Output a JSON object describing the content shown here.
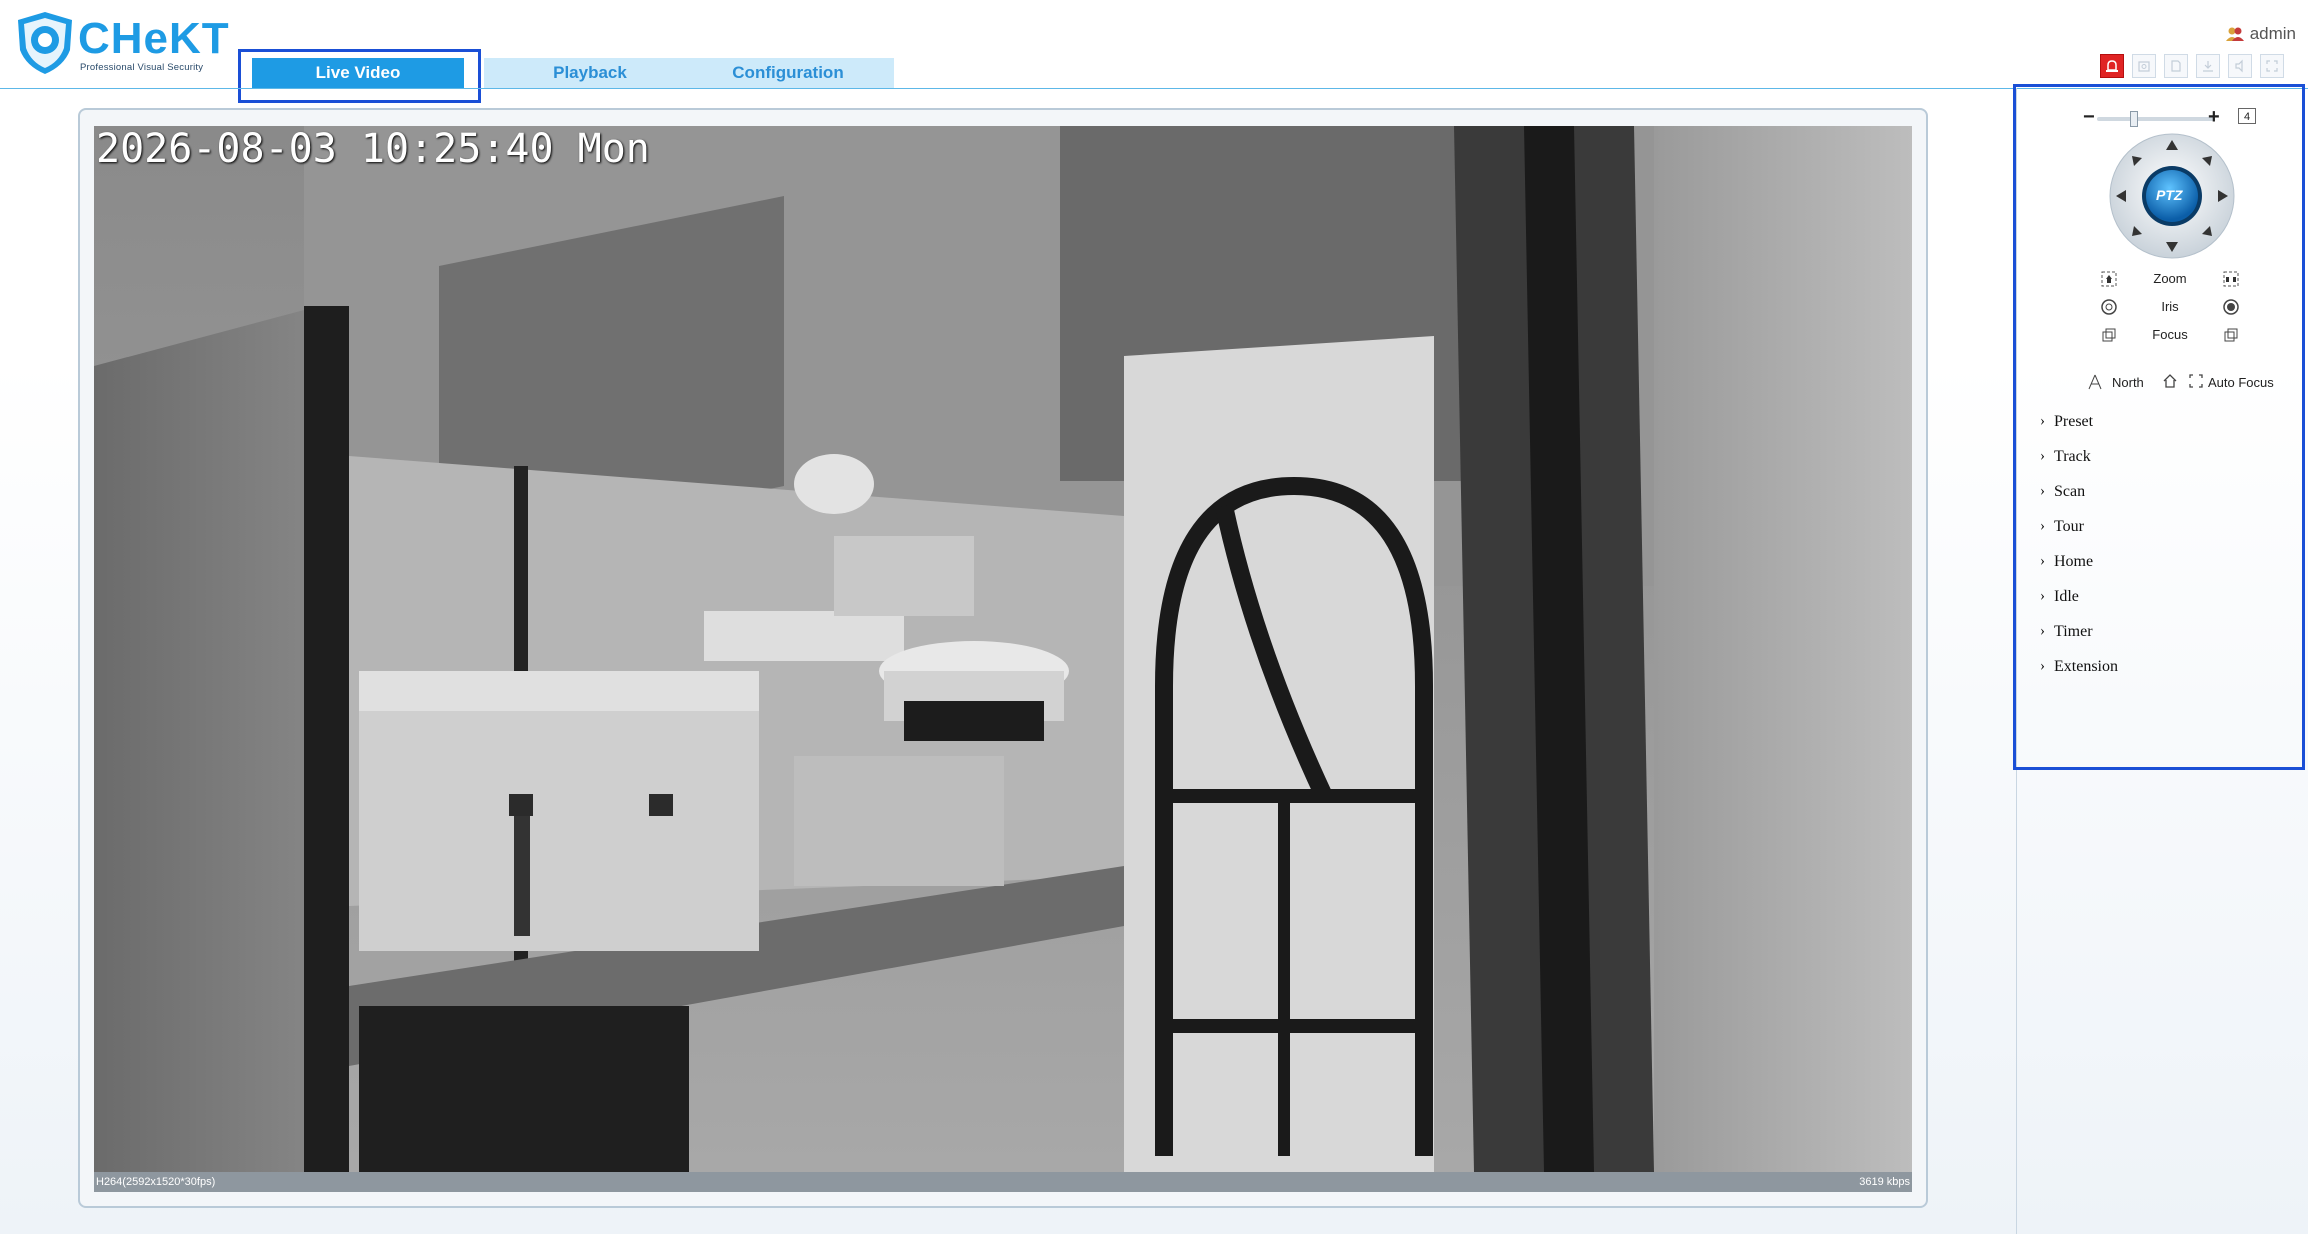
{
  "app": {
    "logo_text": "CHeKT",
    "logo_tagline": "Professional Visual Security",
    "brand_color": "#1e9be4"
  },
  "nav": {
    "tabs": [
      {
        "label": "Live Video",
        "active": true
      },
      {
        "label": "Playback",
        "active": false
      },
      {
        "label": "Configuration",
        "active": false
      }
    ]
  },
  "header": {
    "user": "admin",
    "toolbar_icons": [
      "alarm-icon",
      "snapshot-icon",
      "record-icon",
      "download-icon",
      "audio-icon",
      "fullscreen-icon"
    ]
  },
  "video": {
    "osd_timestamp": "2026-08-03 10:25:40 Mon",
    "stream_info": "H264(2592x1520*30fps)",
    "bitrate": "3619 kbps"
  },
  "ptz": {
    "zoom_value": "4",
    "zoom_fraction": 0.3,
    "center_label": "PTZ",
    "controls": [
      {
        "label": "Zoom",
        "left_icon": "zoom-in-icon",
        "right_icon": "zoom-out-icon"
      },
      {
        "label": "Iris",
        "left_icon": "iris-open-icon",
        "right_icon": "iris-close-icon"
      },
      {
        "label": "Focus",
        "left_icon": "focus-near-icon",
        "right_icon": "focus-far-icon"
      }
    ],
    "north_label": "North",
    "auto_focus_label": "Auto Focus",
    "menu": [
      "Preset",
      "Track",
      "Scan",
      "Tour",
      "Home",
      "Idle",
      "Timer",
      "Extension"
    ]
  },
  "highlight_color": "#1a4fd6"
}
